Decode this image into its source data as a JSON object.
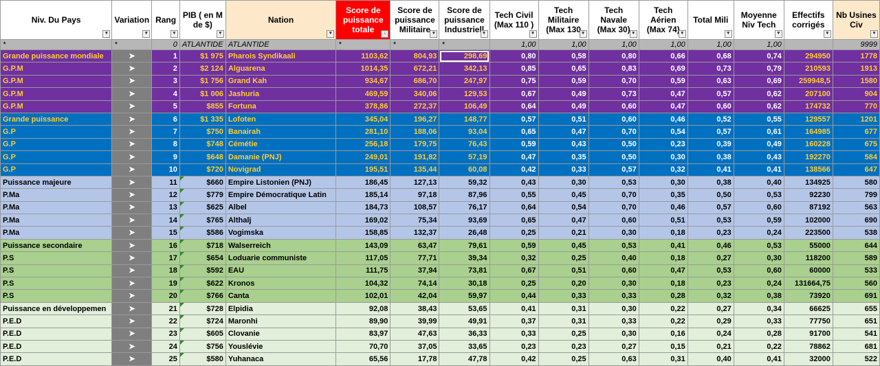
{
  "headers": [
    {
      "label": "Niv. Du Pays",
      "cls": ""
    },
    {
      "label": "Variation",
      "cls": ""
    },
    {
      "label": "Rang",
      "cls": ""
    },
    {
      "label": "PIB ( en M de $)",
      "cls": ""
    },
    {
      "label": "Nation",
      "cls": "nation"
    },
    {
      "label": "Score de puissance totale",
      "cls": "score-total",
      "sorted": true
    },
    {
      "label": "Score de puissance Militaire",
      "cls": ""
    },
    {
      "label": "Score de puissance Industriell",
      "cls": ""
    },
    {
      "label": "Tech Civil (Max 110 )",
      "cls": ""
    },
    {
      "label": "Tech Militaire (Max 130",
      "cls": ""
    },
    {
      "label": "Tech Navale (Max 30)",
      "cls": ""
    },
    {
      "label": "Tech Aérien (Max 74)",
      "cls": ""
    },
    {
      "label": "Total Mili",
      "cls": ""
    },
    {
      "label": "Moyenne Niv Tech",
      "cls": ""
    },
    {
      "label": "Effectifs corrigés",
      "cls": ""
    },
    {
      "label": "Nb Usines Civ",
      "cls": "usines"
    }
  ],
  "filter_row": [
    "*",
    "*",
    "0",
    "ATLANTIDE",
    "ATLANTIDE",
    "*",
    "*",
    "*",
    "1,00",
    "1,00",
    "1,00",
    "1,00",
    "1,00",
    "1,00",
    "",
    "9999"
  ],
  "variation_symbol": "➤",
  "rows": [
    {
      "cls": "gpm",
      "niv": "Grande puissance mondiale",
      "rang": "1",
      "pib": "$1 975",
      "nation": "Pharois Syndikaali",
      "tot": "1103,62",
      "mil": "804,93",
      "ind": "298,69",
      "tc": "0,80",
      "tm": "0,58",
      "tn": "0,80",
      "ta": "0,66",
      "tmili": "0,68",
      "moy": "0,74",
      "eff": "294950",
      "usi": "1778"
    },
    {
      "cls": "gpm",
      "niv": "G.P.M",
      "rang": "2",
      "pib": "$2 124",
      "nation": "Alguarena",
      "tot": "1014,35",
      "mil": "672,21",
      "ind": "342,13",
      "tc": "0,85",
      "tm": "0,65",
      "tn": "0,83",
      "ta": "0,69",
      "tmili": "0,73",
      "moy": "0,79",
      "eff": "210593",
      "usi": "1913"
    },
    {
      "cls": "gpm",
      "niv": "G.P.M",
      "rang": "3",
      "pib": "$1 756",
      "nation": "Grand Kah",
      "tot": "934,67",
      "mil": "686,70",
      "ind": "247,97",
      "tc": "0,75",
      "tm": "0,59",
      "tn": "0,70",
      "ta": "0,59",
      "tmili": "0,63",
      "moy": "0,69",
      "eff": "259948,5",
      "usi": "1580"
    },
    {
      "cls": "gpm",
      "niv": "G.P.M",
      "rang": "4",
      "pib": "$1 006",
      "nation": "Jashuria",
      "tot": "469,59",
      "mil": "340,06",
      "ind": "129,53",
      "tc": "0,67",
      "tm": "0,49",
      "tn": "0,73",
      "ta": "0,47",
      "tmili": "0,57",
      "moy": "0,62",
      "eff": "207100",
      "usi": "904"
    },
    {
      "cls": "gpm",
      "niv": "G.P.M",
      "rang": "5",
      "pib": "$855",
      "nation": "Fortuna",
      "tot": "378,86",
      "mil": "272,37",
      "ind": "106,49",
      "tc": "0,64",
      "tm": "0,49",
      "tn": "0,60",
      "ta": "0,47",
      "tmili": "0,60",
      "moy": "0,62",
      "eff": "174732",
      "usi": "770"
    },
    {
      "cls": "gp",
      "niv": "Grande puissance",
      "rang": "6",
      "pib": "$1 335",
      "nation": "Lofoten",
      "tot": "345,04",
      "mil": "196,27",
      "ind": "148,77",
      "tc": "0,57",
      "tm": "0,51",
      "tn": "0,60",
      "ta": "0,46",
      "tmili": "0,52",
      "moy": "0,55",
      "eff": "129557",
      "usi": "1201"
    },
    {
      "cls": "gp",
      "niv": "G.P",
      "rang": "7",
      "pib": "$750",
      "nation": "Banairah",
      "tot": "281,10",
      "mil": "188,06",
      "ind": "93,04",
      "tc": "0,65",
      "tm": "0,47",
      "tn": "0,70",
      "ta": "0,54",
      "tmili": "0,57",
      "moy": "0,61",
      "eff": "164985",
      "usi": "677"
    },
    {
      "cls": "gp",
      "niv": "G.P",
      "rang": "8",
      "pib": "$748",
      "nation": "Cémétie",
      "tot": "256,18",
      "mil": "179,75",
      "ind": "76,43",
      "tc": "0,59",
      "tm": "0,43",
      "tn": "0,50",
      "ta": "0,23",
      "tmili": "0,39",
      "moy": "0,49",
      "eff": "160228",
      "usi": "675"
    },
    {
      "cls": "gp",
      "niv": "G.P",
      "rang": "9",
      "pib": "$648",
      "nation": "Damanie (PNJ)",
      "tot": "249,01",
      "mil": "191,82",
      "ind": "57,19",
      "tc": "0,47",
      "tm": "0,35",
      "tn": "0,50",
      "ta": "0,30",
      "tmili": "0,38",
      "moy": "0,43",
      "eff": "192270",
      "usi": "584"
    },
    {
      "cls": "gp",
      "niv": "G.P",
      "rang": "10",
      "pib": "$720",
      "nation": "Novigrad",
      "tot": "195,51",
      "mil": "135,44",
      "ind": "60,08",
      "tc": "0,42",
      "tm": "0,33",
      "tn": "0,57",
      "ta": "0,32",
      "tmili": "0,41",
      "moy": "0,41",
      "eff": "138566",
      "usi": "647"
    },
    {
      "cls": "pma",
      "niv": "Puissance majeure",
      "rang": "11",
      "pib": "$660",
      "nation": "Empire Listonien (PNJ)",
      "tot": "186,45",
      "mil": "127,13",
      "ind": "59,32",
      "tc": "0,43",
      "tm": "0,30",
      "tn": "0,53",
      "ta": "0,30",
      "tmili": "0,38",
      "moy": "0,40",
      "eff": "134925",
      "usi": "580"
    },
    {
      "cls": "pma",
      "niv": "P.Ma",
      "rang": "12",
      "pib": "$779",
      "nation": "Empire Démocratique Latin",
      "tot": "185,14",
      "mil": "97,18",
      "ind": "87,96",
      "tc": "0,55",
      "tm": "0,45",
      "tn": "0,70",
      "ta": "0,35",
      "tmili": "0,50",
      "moy": "0,53",
      "eff": "92230",
      "usi": "799"
    },
    {
      "cls": "pma",
      "niv": "P.Ma",
      "rang": "13",
      "pib": "$625",
      "nation": "Albel",
      "tot": "184,73",
      "mil": "108,57",
      "ind": "76,17",
      "tc": "0,64",
      "tm": "0,54",
      "tn": "0,70",
      "ta": "0,46",
      "tmili": "0,57",
      "moy": "0,60",
      "eff": "87192",
      "usi": "563"
    },
    {
      "cls": "pma",
      "niv": "P.Ma",
      "rang": "14",
      "pib": "$765",
      "nation": "Althalj",
      "tot": "169,02",
      "mil": "75,34",
      "ind": "93,69",
      "tc": "0,65",
      "tm": "0,47",
      "tn": "0,60",
      "ta": "0,51",
      "tmili": "0,53",
      "moy": "0,59",
      "eff": "102000",
      "usi": "690"
    },
    {
      "cls": "pma",
      "niv": "P.Ma",
      "rang": "15",
      "pib": "$586",
      "nation": "Vogimska",
      "tot": "158,85",
      "mil": "132,37",
      "ind": "26,48",
      "tc": "0,25",
      "tm": "0,21",
      "tn": "0,30",
      "ta": "0,18",
      "tmili": "0,23",
      "moy": "0,24",
      "eff": "223500",
      "usi": "538"
    },
    {
      "cls": "ps",
      "niv": "Puissance secondaire",
      "rang": "16",
      "pib": "$718",
      "nation": "Walserreich",
      "tot": "143,09",
      "mil": "63,47",
      "ind": "79,61",
      "tc": "0,59",
      "tm": "0,45",
      "tn": "0,53",
      "ta": "0,41",
      "tmili": "0,46",
      "moy": "0,53",
      "eff": "55000",
      "usi": "644"
    },
    {
      "cls": "ps",
      "niv": "P.S",
      "rang": "17",
      "pib": "$654",
      "nation": "Loduarie communiste",
      "tot": "117,05",
      "mil": "77,71",
      "ind": "39,34",
      "tc": "0,32",
      "tm": "0,25",
      "tn": "0,40",
      "ta": "0,18",
      "tmili": "0,27",
      "moy": "0,30",
      "eff": "118200",
      "usi": "589"
    },
    {
      "cls": "ps",
      "niv": "P.S",
      "rang": "18",
      "pib": "$592",
      "nation": "EAU",
      "tot": "111,75",
      "mil": "37,94",
      "ind": "73,81",
      "tc": "0,67",
      "tm": "0,51",
      "tn": "0,60",
      "ta": "0,47",
      "tmili": "0,53",
      "moy": "0,60",
      "eff": "60000",
      "usi": "533"
    },
    {
      "cls": "ps",
      "niv": "P.S",
      "rang": "19",
      "pib": "$622",
      "nation": "Kronos",
      "tot": "104,32",
      "mil": "74,14",
      "ind": "30,18",
      "tc": "0,25",
      "tm": "0,20",
      "tn": "0,30",
      "ta": "0,18",
      "tmili": "0,23",
      "moy": "0,24",
      "eff": "131664,75",
      "usi": "560"
    },
    {
      "cls": "ps",
      "niv": "P.S",
      "rang": "20",
      "pib": "$766",
      "nation": "Canta",
      "tot": "102,01",
      "mil": "42,04",
      "ind": "59,97",
      "tc": "0,44",
      "tm": "0,33",
      "tn": "0,33",
      "ta": "0,28",
      "tmili": "0,32",
      "moy": "0,38",
      "eff": "73920",
      "usi": "691"
    },
    {
      "cls": "ped",
      "niv": "Puissance en développemen",
      "rang": "21",
      "pib": "$728",
      "nation": "Elpidia",
      "tot": "92,08",
      "mil": "38,43",
      "ind": "53,65",
      "tc": "0,41",
      "tm": "0,31",
      "tn": "0,30",
      "ta": "0,22",
      "tmili": "0,27",
      "moy": "0,34",
      "eff": "66625",
      "usi": "655"
    },
    {
      "cls": "ped",
      "niv": "P.E.D",
      "rang": "22",
      "pib": "$724",
      "nation": "Maronhi",
      "tot": "89,90",
      "mil": "39,99",
      "ind": "49,91",
      "tc": "0,37",
      "tm": "0,31",
      "tn": "0,33",
      "ta": "0,22",
      "tmili": "0,29",
      "moy": "0,33",
      "eff": "77750",
      "usi": "651"
    },
    {
      "cls": "ped",
      "niv": "P.E.D",
      "rang": "23",
      "pib": "$605",
      "nation": "Clovanie",
      "tot": "83,97",
      "mil": "47,63",
      "ind": "36,33",
      "tc": "0,33",
      "tm": "0,25",
      "tn": "0,30",
      "ta": "0,16",
      "tmili": "0,24",
      "moy": "0,28",
      "eff": "91700",
      "usi": "541"
    },
    {
      "cls": "ped",
      "niv": "P.E.D",
      "rang": "24",
      "pib": "$756",
      "nation": "Youslévie",
      "tot": "70,70",
      "mil": "37,05",
      "ind": "33,65",
      "tc": "0,23",
      "tm": "0,23",
      "tn": "0,27",
      "ta": "0,15",
      "tmili": "0,21",
      "moy": "0,22",
      "eff": "78862",
      "usi": "681"
    },
    {
      "cls": "ped",
      "niv": "P.E.D",
      "rang": "25",
      "pib": "$580",
      "nation": "Yuhanaca",
      "tot": "65,56",
      "mil": "17,78",
      "ind": "47,78",
      "tc": "0,42",
      "tm": "0,25",
      "tn": "0,63",
      "ta": "0,31",
      "tmili": "0,40",
      "moy": "0,41",
      "eff": "32000",
      "usi": "522"
    }
  ]
}
